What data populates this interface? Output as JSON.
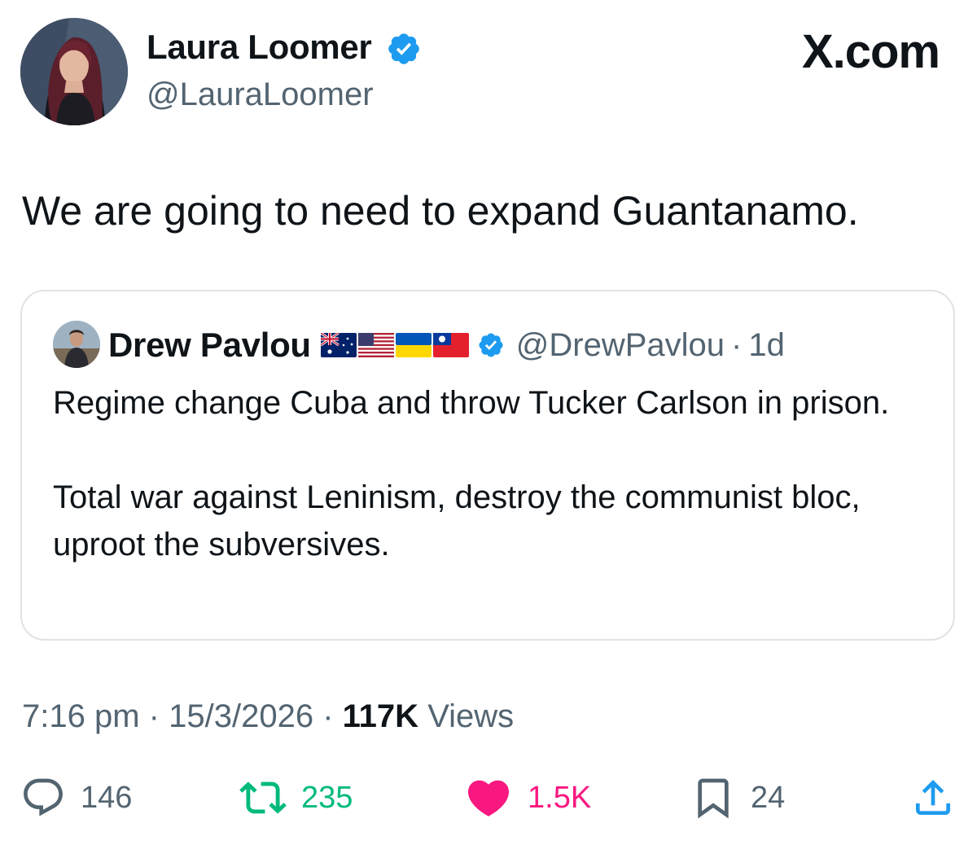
{
  "header": {
    "author_name": "Laura Loomer",
    "author_handle": "@LauraLoomer",
    "brand": "X.com"
  },
  "tweet": {
    "text": "We are going to need to expand Guantanamo."
  },
  "quoted_tweet": {
    "author_name": "Drew Pavlou",
    "flags": [
      "australia-flag-icon",
      "usa-flag-icon",
      "ukraine-flag-icon",
      "taiwan-flag-icon"
    ],
    "author_handle": "@DrewPavlou",
    "time_separator": "·",
    "age": "1d",
    "paragraphs": [
      "Regime change Cuba and throw Tucker Carlson in prison.",
      "Total war against Leninism, destroy the communist bloc, uproot the subversives."
    ]
  },
  "meta": {
    "time": "7:16 pm",
    "separator": "·",
    "date": "15/3/2026",
    "views_count": "117K",
    "views_label": "Views"
  },
  "actions": {
    "replies": "146",
    "retweets": "235",
    "likes": "1.5K",
    "bookmarks": "24"
  },
  "colors": {
    "verified": "#1d9bf0",
    "secondary_text": "#536471",
    "retweet": "#00ba7c",
    "like": "#f91880",
    "border": "#dfe3e6"
  }
}
